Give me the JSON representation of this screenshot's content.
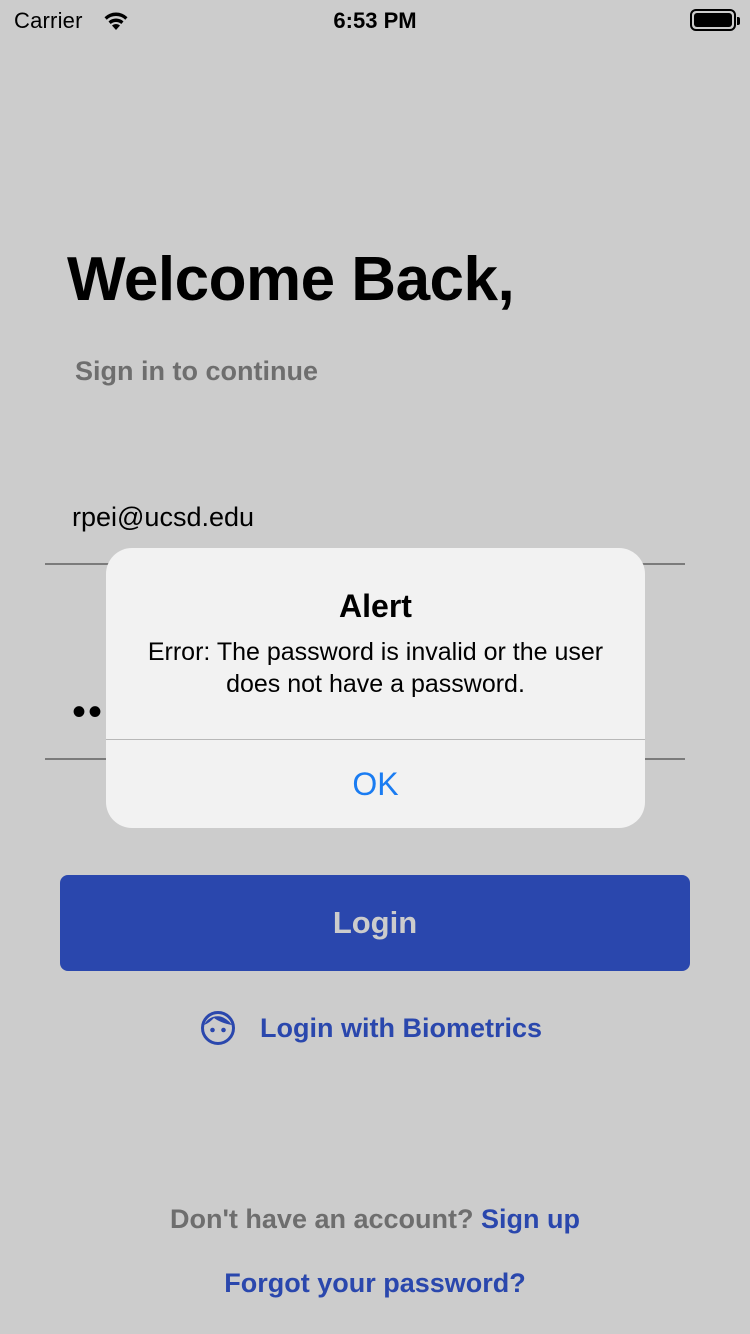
{
  "status_bar": {
    "carrier": "Carrier",
    "time": "6:53 PM",
    "wifi_icon": "wifi-icon",
    "battery_icon": "battery-icon"
  },
  "login": {
    "title": "Welcome Back,",
    "subtitle": "Sign in to continue",
    "email_value": "rpei@ucsd.edu",
    "password_masked": "••",
    "login_label": "Login",
    "biometrics_icon": "face-icon",
    "biometrics_label": "Login with Biometrics",
    "signup_prompt": "Don't have an account?",
    "signup_link": "Sign up",
    "forgot_password": "Forgot your password?"
  },
  "alert": {
    "title": "Alert",
    "message": "Error: The password is invalid or the user does not have a password.",
    "ok_label": "OK"
  },
  "colors": {
    "accent": "#3559d9",
    "alert_button": "#1a7cf2",
    "muted_text": "#8a8a8a",
    "overlay": "rgba(0,0,0,0.20)"
  }
}
